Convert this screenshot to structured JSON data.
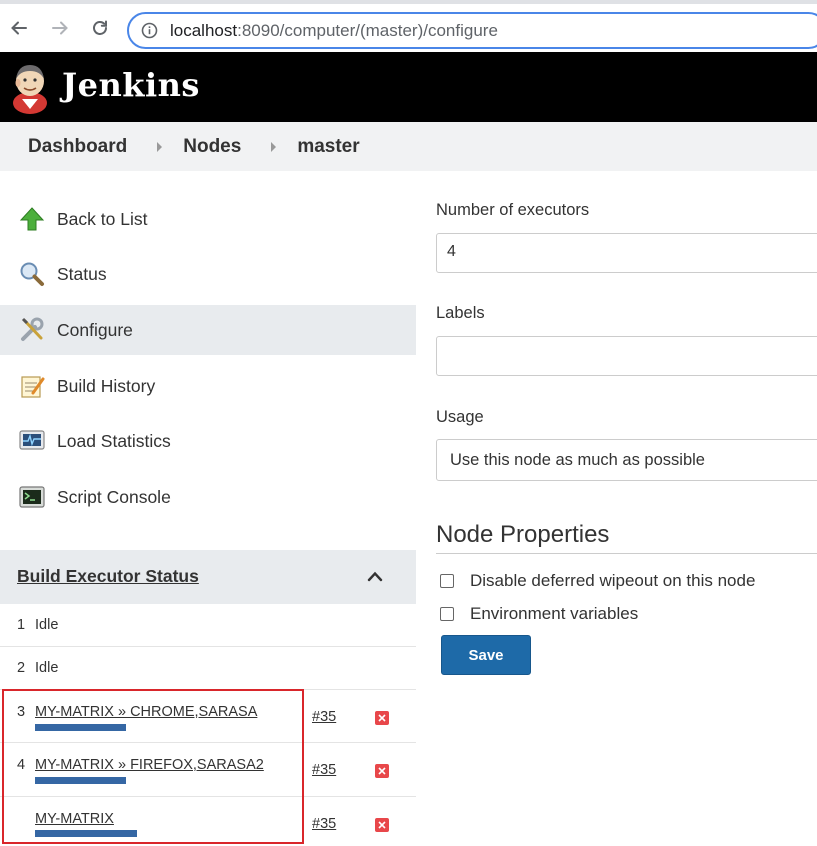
{
  "browser": {
    "url_host": "localhost",
    "url_path": ":8090/computer/(master)/configure"
  },
  "header": {
    "title": "Jenkins"
  },
  "breadcrumb": {
    "items": [
      "Dashboard",
      "Nodes",
      "master"
    ]
  },
  "sidebar": {
    "tasks": [
      {
        "label": "Back to List",
        "icon": "up-arrow-icon"
      },
      {
        "label": "Status",
        "icon": "magnifier-icon"
      },
      {
        "label": "Configure",
        "icon": "wrench-screwdriver-icon",
        "active": true
      },
      {
        "label": "Build History",
        "icon": "notepad-icon"
      },
      {
        "label": "Load Statistics",
        "icon": "monitor-graph-icon"
      },
      {
        "label": "Script Console",
        "icon": "terminal-icon"
      }
    ],
    "executor_status": {
      "title": "Build Executor Status",
      "rows": [
        {
          "num": "1",
          "status": "Idle"
        },
        {
          "num": "2",
          "status": "Idle"
        },
        {
          "num": "3",
          "job": "MY-MATRIX » CHROME,SARASA",
          "build": "#35"
        },
        {
          "num": "4",
          "job": "MY-MATRIX » FIREFOX,SARASA2",
          "build": "#35"
        },
        {
          "num": "",
          "job": "MY-MATRIX",
          "build": "#35"
        }
      ]
    }
  },
  "form": {
    "executors_label": "Number of executors",
    "executors_value": "4",
    "labels_label": "Labels",
    "labels_value": "",
    "usage_label": "Usage",
    "usage_value": "Use this node as much as possible",
    "node_properties_title": "Node Properties",
    "checkboxes": [
      {
        "label": "Disable deferred wipeout on this node",
        "checked": false
      },
      {
        "label": "Environment variables",
        "checked": false
      }
    ],
    "save_label": "Save"
  },
  "colors": {
    "header_bg": "#000000",
    "save_button": "#1e6aa8",
    "highlight_box": "#d9262b",
    "progress_bar": "#3567a4"
  }
}
